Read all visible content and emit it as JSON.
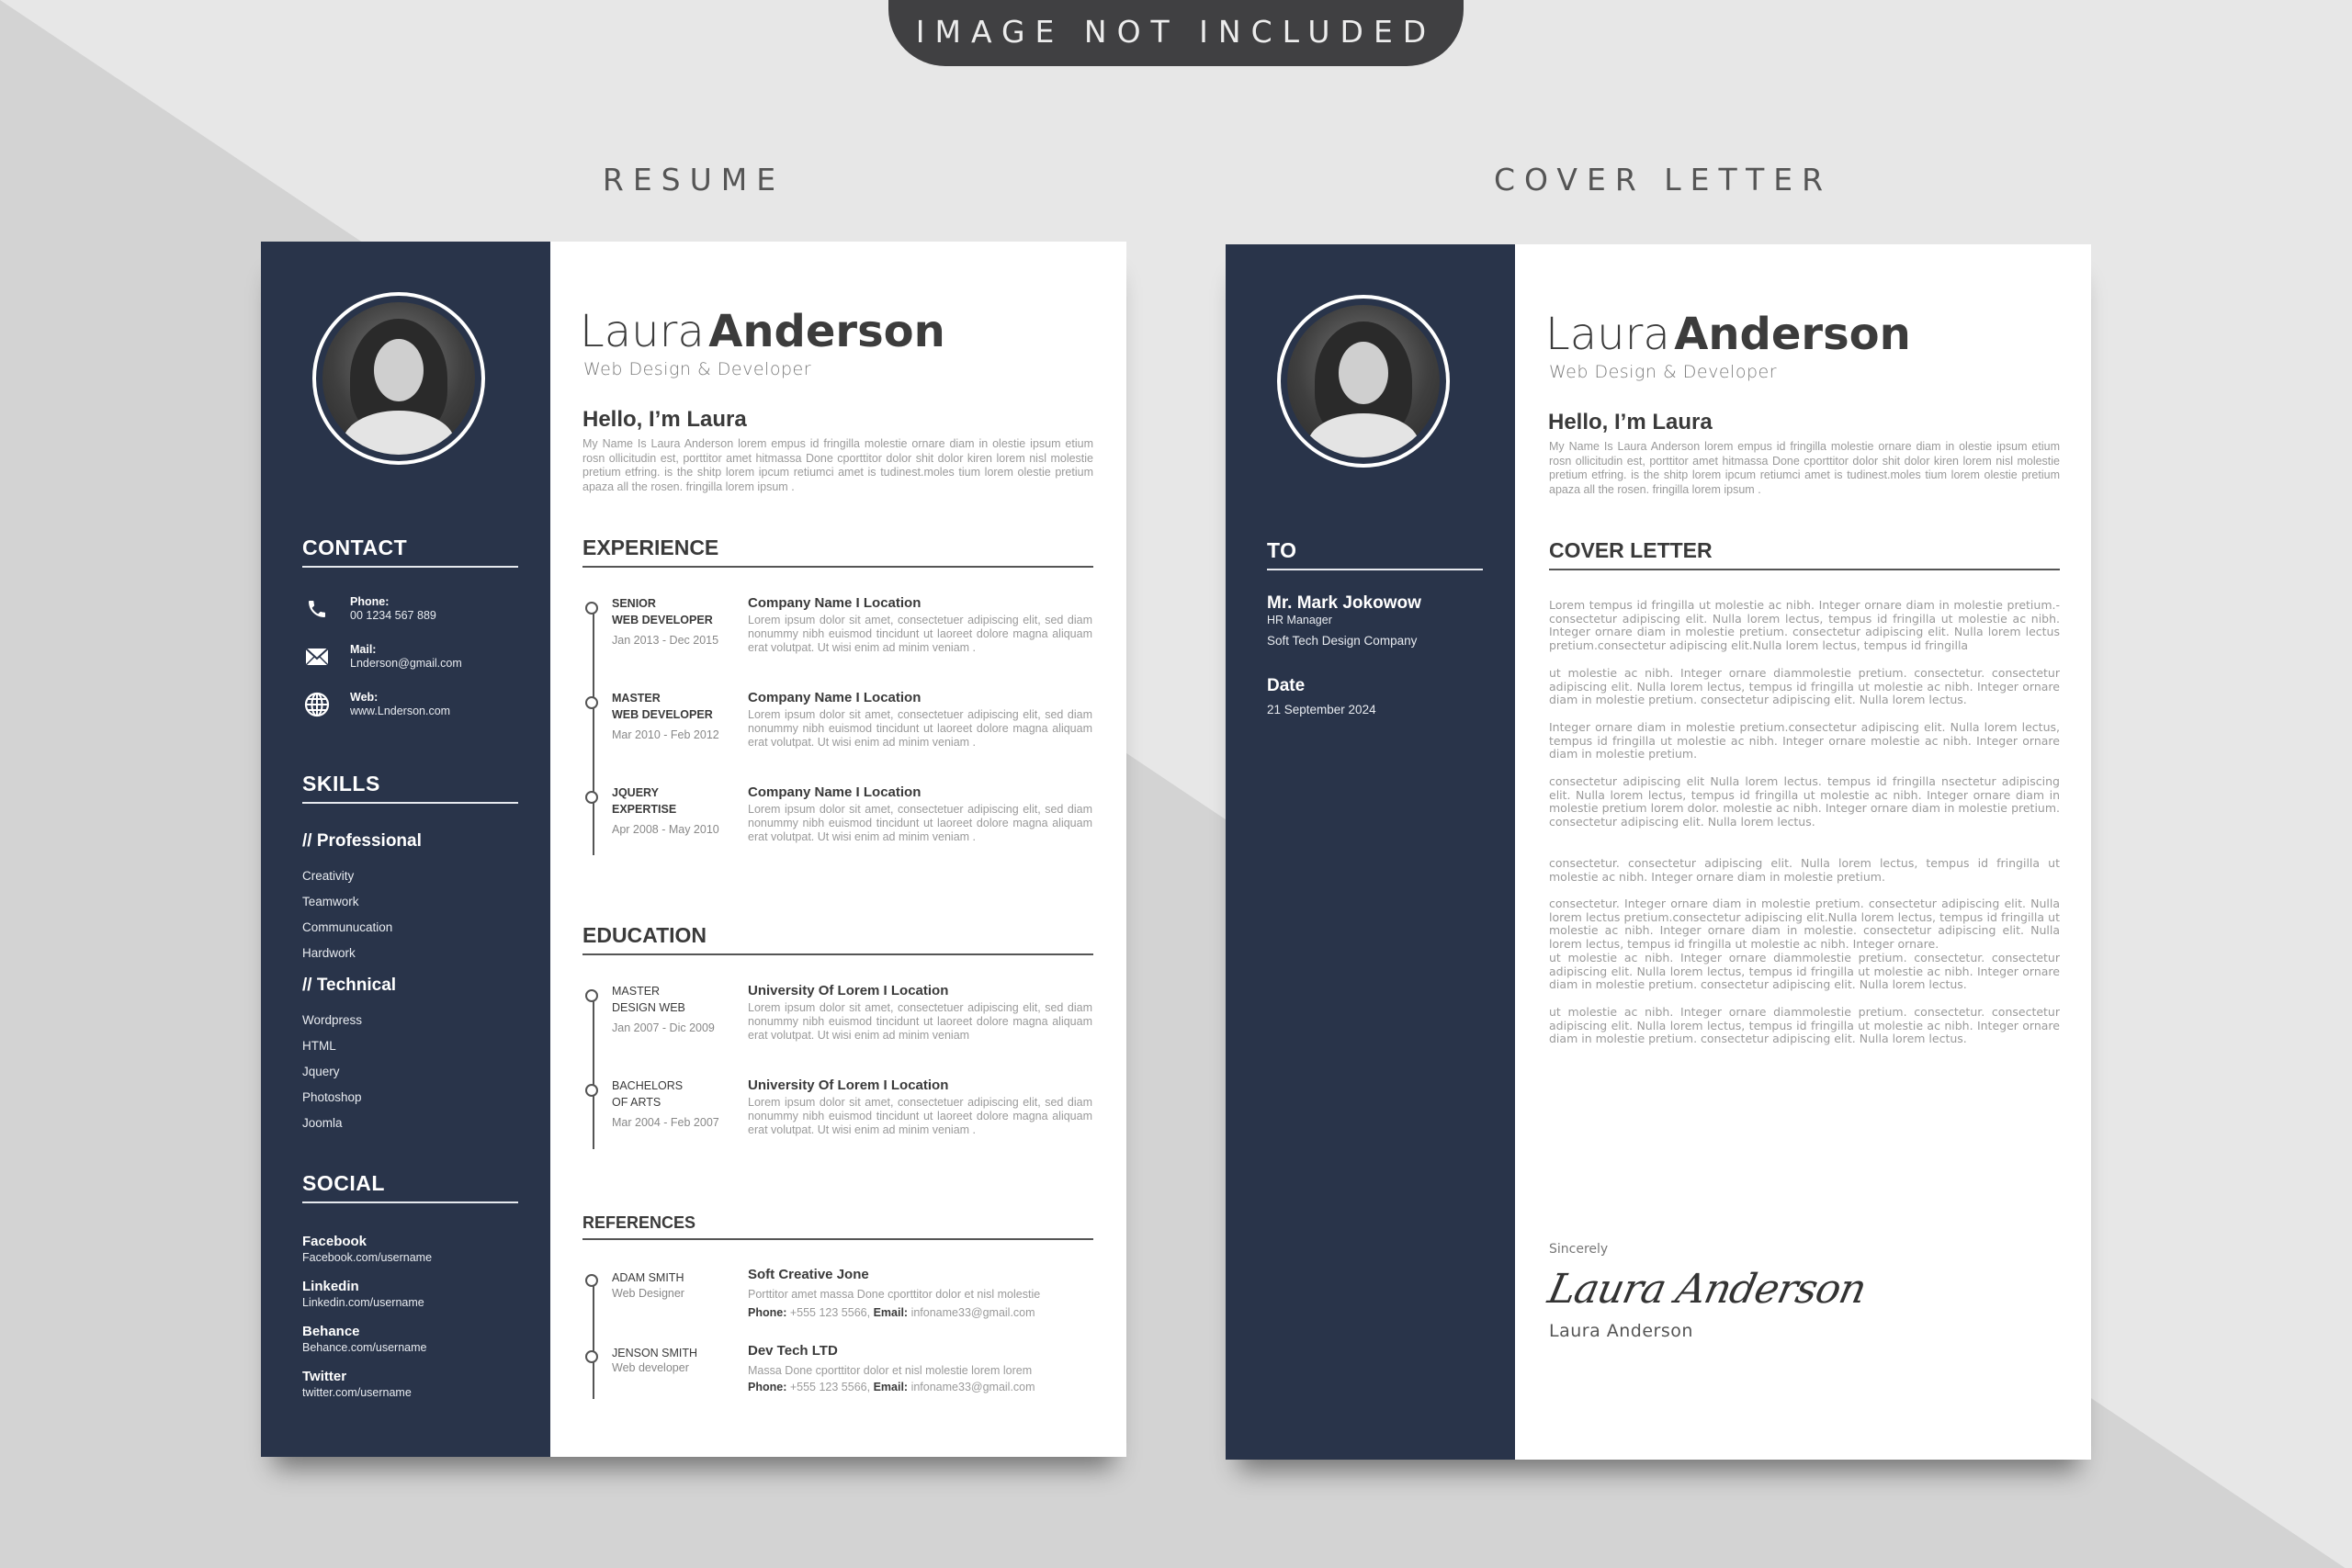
{
  "banner": {
    "text": "IMAGE NOT INCLUDED"
  },
  "colors": {
    "sidebar": "#29344a",
    "background_light": "#e7e7e7",
    "background_dark": "#d3d3d3",
    "banner": "#404042"
  },
  "resume": {
    "label": "RESUME",
    "first_name": "Laura",
    "last_name": "Anderson",
    "title": "Web Design & Developer",
    "hello": "Hello, I’m Laura",
    "intro": "My Name Is Laura Anderson lorem empus  id fringilla molestie ornare diam in olestie ipsum etium rosn ollicitudin est, porttitor amet hitmassa Done cporttitor dolor shit dolor kiren lorem nisl molestie pretium etfring. is the shitp lorem ipcum retiumci amet is tudinest.moles tium lorem olestie pretium apaza all the rosen.  fringilla lorem ipsum .",
    "sidebar": {
      "contact_title": "CONTACT",
      "contacts": [
        {
          "icon": "phone-icon",
          "label": "Phone:",
          "value": "00 1234 567 889"
        },
        {
          "icon": "mail-icon",
          "label": "Mail:",
          "value": "Lnderson@gmail.com"
        },
        {
          "icon": "globe-icon",
          "label": "Web:",
          "value": "www.Lnderson.com"
        }
      ],
      "skills_title": "SKILLS",
      "professional_title": "// Professional",
      "professional": [
        "Creativity",
        "Teamwork",
        "Communucation",
        "Hardwork"
      ],
      "technical_title": "// Technical",
      "technical": [
        "Wordpress",
        "HTML",
        "Jquery",
        "Photoshop",
        "Joomla"
      ],
      "social_title": "SOCIAL",
      "social": [
        {
          "name": "Facebook",
          "url": "Facebook.com/username"
        },
        {
          "name": "Linkedin",
          "url": "Linkedin.com/username"
        },
        {
          "name": "Behance",
          "url": "Behance.com/username"
        },
        {
          "name": "Twitter",
          "url": "twitter.com/username"
        }
      ]
    },
    "experience_title": "EXPERIENCE",
    "experience": [
      {
        "role1": "SENIOR",
        "role2": "WEB DEVELOPER",
        "dates": "Jan 2013 - Dec 2015",
        "heading": "Company Name  I  Location",
        "desc": "Lorem ipsum dolor sit amet, consectetuer adipiscing elit, sed diam nonummy nibh euismod tincidunt ut laoreet dolore magna aliquam erat volutpat. Ut wisi enim ad minim veniam ."
      },
      {
        "role1": "MASTER",
        "role2": "WEB DEVELOPER",
        "dates": "Mar 2010 - Feb 2012",
        "heading": "Company Name  I  Location",
        "desc": "Lorem ipsum dolor sit amet, consectetuer adipiscing elit, sed diam nonummy nibh euismod tincidunt ut laoreet dolore magna aliquam erat volutpat. Ut wisi enim ad minim veniam ."
      },
      {
        "role1": "JQUERY",
        "role2": "EXPERTISE",
        "dates": "Apr 2008 - May 2010",
        "heading": "Company Name  I  Location",
        "desc": "Lorem ipsum dolor sit amet, consectetuer adipiscing elit, sed diam nonummy nibh euismod tincidunt ut laoreet dolore magna aliquam erat volutpat. Ut wisi enim ad minim veniam ."
      }
    ],
    "education_title": "EDUCATION",
    "education": [
      {
        "role1": "MASTER",
        "role2": "DESIGN WEB",
        "dates": "Jan 2007 - Dic 2009",
        "heading": "University Of Lorem  I  Location",
        "desc": "Lorem ipsum dolor sit amet, consectetuer adipiscing elit, sed diam nonummy nibh euismod tincidunt ut laoreet dolore magna aliquam erat volutpat. Ut wisi enim ad minim veniam"
      },
      {
        "role1": "BACHELORS",
        "role2": "OF ARTS",
        "dates": "Mar 2004 - Feb 2007",
        "heading": "University Of Lorem  I  Location",
        "desc": "Lorem ipsum dolor sit amet, consectetuer adipiscing elit, sed diam nonummy nibh euismod tincidunt ut laoreet dolore magna aliquam erat volutpat. Ut wisi enim ad minim veniam ."
      }
    ],
    "references_title": "REFERENCES",
    "references": [
      {
        "name": "ADAM SMITH",
        "role": "Web Designer",
        "company": "Soft Creative Jone",
        "desc": "Porttitor amet massa Done cporttitor dolor et nisl molestie",
        "phone_label": "Phone:",
        "phone": "+555 123 5566,",
        "email_label": "Email:",
        "email": "infoname33@gmail.com"
      },
      {
        "name": "JENSON SMITH",
        "role": "Web developer",
        "company": "Dev Tech LTD",
        "desc": "Massa Done cporttitor dolor et nisl molestie lorem lorem",
        "phone_label": "Phone:",
        "phone": "+555 123 5566,",
        "email_label": "Email:",
        "email": "infoname33@gmail.com"
      }
    ]
  },
  "cover": {
    "label": "COVER LETTER",
    "first_name": "Laura",
    "last_name": "Anderson",
    "title": "Web Design & Developer",
    "hello": "Hello, I’m Laura",
    "intro": "My Name Is Laura Anderson lorem empus  id fringilla molestie ornare diam in olestie ipsum etium rosn ollicitudin est, porttitor amet hitmassa Done cporttitor dolor shit dolor kiren lorem nisl molestie pretium etfring. is the shitp lorem ipcum retiumci amet is tudinest.moles tium lorem olestie pretium apaza all the rosen.  fringilla lorem ipsum .",
    "to_title": "TO",
    "recipient_name": "Mr. Mark Jokowow",
    "recipient_role": "HR Manager",
    "recipient_company": "Soft Tech Design Company",
    "date_title": "Date",
    "date": "21 September 2024",
    "letter_title": "COVER LETTER",
    "paragraphs": [
      "Lorem tempus id fringilla ut molestie ac nibh. Integer ornare diam in molestie pretium.-consectetur adipiscing elit. Nulla lorem lectus, tempus id fringilla ut molestie ac nibh. Integer ornare diam in molestie pretium. consectetur adipiscing elit. Nulla lorem lectus pretium.consectetur adipiscing elit.Nulla lorem lectus, tempus id fringilla",
      " ut molestie ac nibh. Integer ornare diammolestie pretium. consectetur. consectetur adipiscing elit. Nulla lorem lectus, tempus id fringilla ut molestie ac nibh. Integer ornare diam in molestie  pretium. consectetur adipiscing elit. Nulla lorem lectus.",
      "Integer ornare diam in molestie pretium.consectetur adipiscing elit. Nulla lorem lectus, tempus id fringilla ut molestie ac nibh. Integer ornare molestie ac nibh. Integer ornare diam in molestie pretium.",
      "consectetur adipiscing elit Nulla lorem lectus.  tempus id fringilla  nsectetur adipiscing elit. Nulla lorem lectus, tempus id fringilla ut molestie ac nibh. Integer ornare diam in molestie pretium lorem dolor.  molestie ac nibh. Integer ornare diam in molestie  pretium. consectetur adipiscing elit. Nulla lorem lectus.",
      "consectetur. consectetur adipiscing elit. Nulla lorem lectus, tempus id fringilla ut molestie ac nibh. Integer ornare diam in molestie pretium.",
      "consectetur. Integer ornare diam in molestie pretium. consectetur adipiscing elit. Nulla lorem lectus pretium.consectetur adipiscing elit.Nulla lorem lectus, tempus id fringilla ut molestie ac nibh. Integer ornare diam in molestie. consectetur adipiscing elit. Nulla lorem lectus, tempus id fringilla ut molestie ac nibh. Integer ornare.",
      " ut molestie ac nibh. Integer ornare diammolestie pretium. consectetur. consectetur adipiscing elit. Nulla lorem lectus, tempus id fringilla ut molestie ac nibh. Integer ornare diam in molestie  pretium. consectetur adipiscing elit. Nulla lorem lectus.",
      " ut molestie ac nibh. Integer ornare diammolestie pretium. consectetur. consectetur adipiscing elit. Nulla lorem lectus, tempus id fringilla ut molestie ac nibh. Integer ornare diam in molestie  pretium. consectetur adipiscing elit. Nulla lorem lectus."
    ],
    "closing": "Sincerely",
    "signature": "Laura Anderson",
    "signer_name": "Laura Anderson"
  }
}
